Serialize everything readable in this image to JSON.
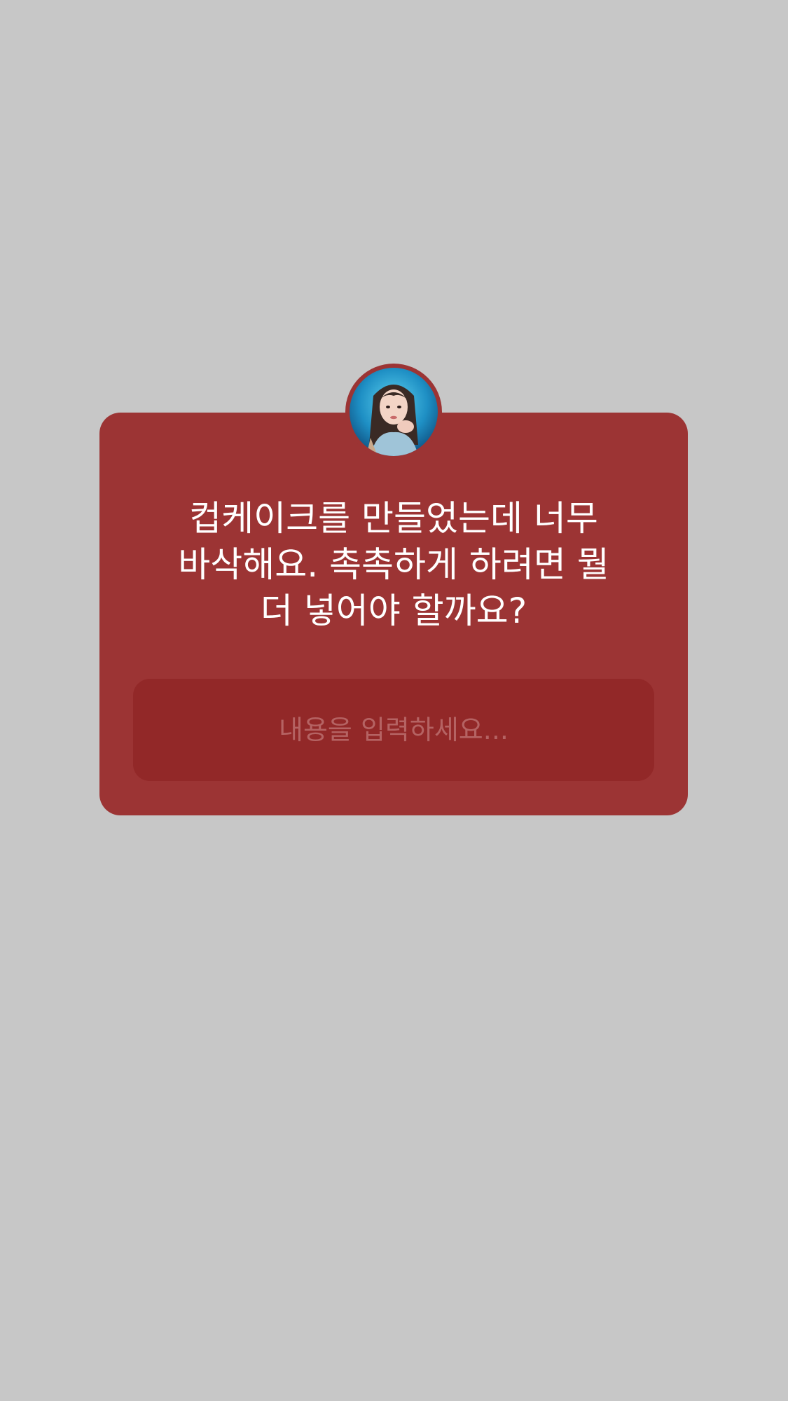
{
  "story": {
    "background_color": "#c7c7c7",
    "question_sticker": {
      "card_color": "#9c3434",
      "field_color": "#922828",
      "avatar_icon": "profile-photo",
      "question_lines": [
        "컵케이크를 만들었는데 너무",
        "바삭해요. 촉촉하게 하려면 뭘",
        "더 넣어야 할까요?"
      ],
      "answer_placeholder": "내용을 입력하세요..."
    }
  }
}
